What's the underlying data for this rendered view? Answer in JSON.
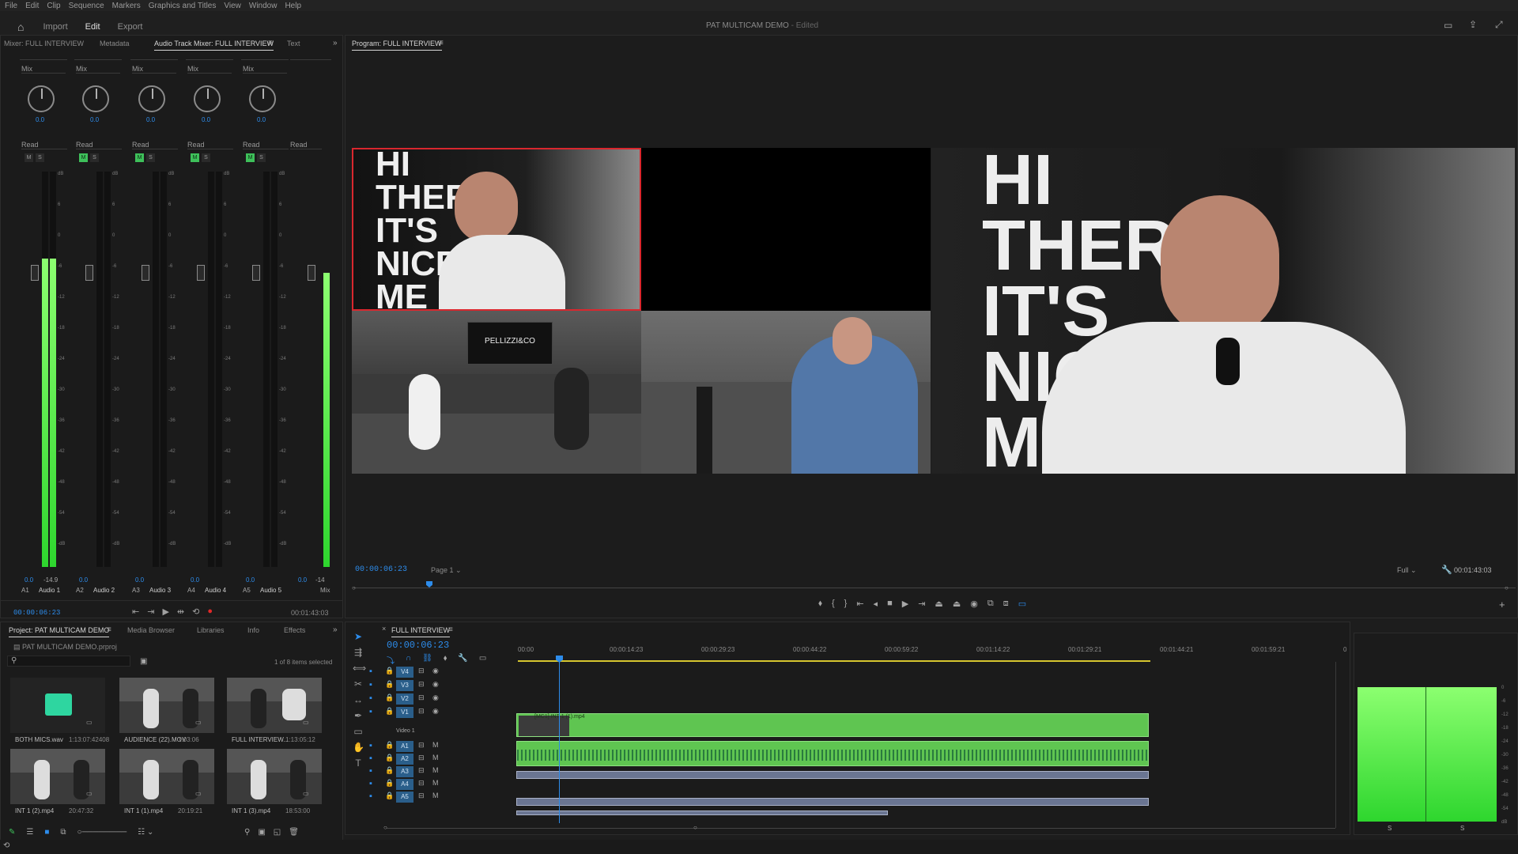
{
  "menu": [
    "File",
    "Edit",
    "Clip",
    "Sequence",
    "Markers",
    "Graphics and Titles",
    "View",
    "Window",
    "Help"
  ],
  "workspace": {
    "tabs": [
      "Import",
      "Edit",
      "Export"
    ],
    "active": "Edit",
    "title": "PAT MULTICAM DEMO",
    "title_suffix": "- Edited"
  },
  "mixer": {
    "tabs": [
      "Mixer: FULL INTERVIEW",
      "Metadata",
      "Audio Track Mixer: FULL INTERVIEW",
      "Text"
    ],
    "mode_label": "Mix",
    "read_label": "Read",
    "pan_value": "0.0",
    "tracks": [
      {
        "id": "A1",
        "name": "Audio 1",
        "level": 0.78,
        "mute_on": false,
        "meter_val": "0.0",
        "peak": "-14.9"
      },
      {
        "id": "A2",
        "name": "Audio 2",
        "level": 0.0,
        "mute_on": true,
        "meter_val": "0.0",
        "peak": ""
      },
      {
        "id": "A3",
        "name": "Audio 3",
        "level": 0.0,
        "mute_on": true,
        "meter_val": "0.0",
        "peak": ""
      },
      {
        "id": "A4",
        "name": "Audio 4",
        "level": 0.0,
        "mute_on": true,
        "meter_val": "0.0",
        "peak": ""
      },
      {
        "id": "A5",
        "name": "Audio 5",
        "level": 0.0,
        "mute_on": true,
        "meter_val": "0.0",
        "peak": ""
      }
    ],
    "master": {
      "name": "Mix",
      "level": 0.8,
      "meter_val": "0.0",
      "peak": "-14"
    },
    "timecode": "00:00:06:23",
    "duration": "00:01:43:03",
    "db_scale": [
      "dB",
      "6",
      "0",
      "-6",
      "-12",
      "-18",
      "-24",
      "-30",
      "-36",
      "-42",
      "-48",
      "-54",
      "-dB"
    ]
  },
  "program": {
    "title": "Program: FULL INTERVIEW",
    "timecode": "00:00:06:23",
    "page": "Page 1",
    "zoom": "Full",
    "duration": "00:01:43:03",
    "cam_sign_lines": [
      "HI",
      "THER",
      "IT'S",
      "NICE",
      "ME"
    ],
    "wide_brand": "PELLIZZI&CO"
  },
  "project": {
    "tabs": [
      "Project: PAT MULTICAM DEMO",
      "Media Browser",
      "Libraries",
      "Info",
      "Effects"
    ],
    "file": "PAT MULTICAM DEMO.prproj",
    "items_count": "1 of 8 items selected",
    "items": [
      {
        "name": "BOTH MICS.wav",
        "dur": "1:13:07:42408"
      },
      {
        "name": "AUDIENCE (22).MOV",
        "dur": "1:03:06"
      },
      {
        "name": "FULL INTERVIEW...",
        "dur": "1:13:05:12"
      },
      {
        "name": "INT 1 (2).mp4",
        "dur": "20:47:32"
      },
      {
        "name": "INT 1 (1).mp4",
        "dur": "20:19:21"
      },
      {
        "name": "INT 1 (3).mp4",
        "dur": "18:53:00"
      }
    ]
  },
  "timeline": {
    "sequence": "FULL INTERVIEW",
    "timecode": "00:00:06:23",
    "ruler": [
      "00:00",
      "00:00:14:23",
      "00:00:29:23",
      "00:00:44:22",
      "00:00:59:22",
      "00:01:14:22",
      "00:01:29:21",
      "00:01:44:21",
      "00:01:59:21",
      "0"
    ],
    "video_tracks": [
      "V4",
      "V3",
      "V2",
      "V1"
    ],
    "audio_tracks": [
      "A1",
      "A2",
      "A3",
      "A4",
      "A5"
    ],
    "v1_label": "Video 1",
    "clip_name": "[MC1] INT 1 (1).mp4"
  },
  "master_meter": {
    "labels": [
      "0",
      "-6",
      "-12",
      "-18",
      "-24",
      "-30",
      "-36",
      "-42",
      "-48",
      "-54",
      "dB"
    ],
    "left": "S",
    "right": "S"
  },
  "colors": {
    "accent": "#2d8ceb",
    "clip_green": "#5fc551",
    "selection_red": "#d9272e"
  }
}
